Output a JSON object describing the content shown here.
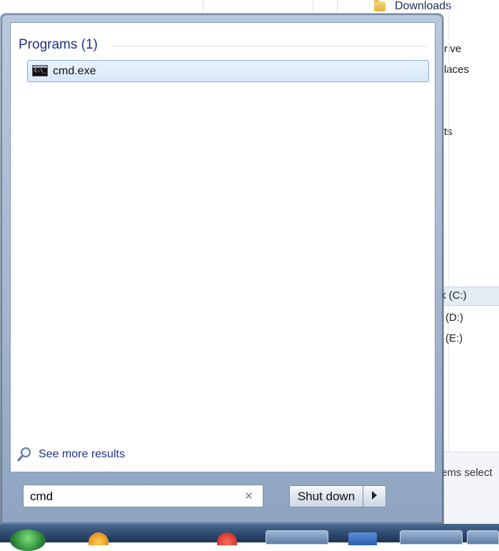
{
  "background_window": {
    "nav_items": [
      "Downloads",
      "rive",
      "laces",
      "ts"
    ],
    "drives": [
      "k (C:)",
      "(D:)",
      "(E:)"
    ],
    "status_text": "ems select"
  },
  "start_menu": {
    "section_header": "Programs (1)",
    "results": [
      {
        "label": "cmd.exe",
        "icon": "cmd-console-icon"
      }
    ],
    "see_more_label": "See more results",
    "search": {
      "value": "cmd",
      "clear_icon": "×"
    },
    "shutdown_label": "Shut down"
  },
  "colors": {
    "header_blue": "#1e3287",
    "selection_border": "#84acdd",
    "menu_frame": "#a4b7cf"
  }
}
